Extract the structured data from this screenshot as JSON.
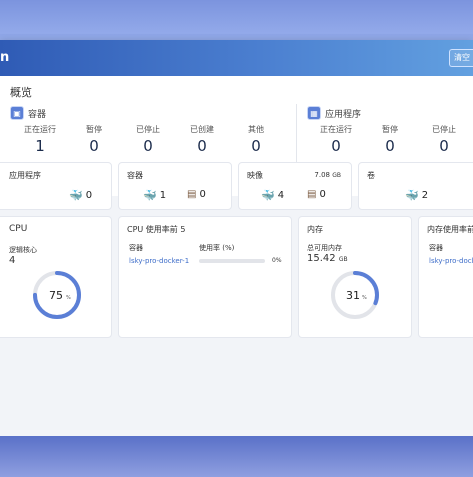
{
  "header": {
    "title": "n",
    "button_label": "清空"
  },
  "overview": {
    "title": "概览",
    "containers": {
      "label": "容器",
      "stats": [
        {
          "label": "正在运行",
          "value": "1"
        },
        {
          "label": "暂停",
          "value": "0"
        },
        {
          "label": "已停止",
          "value": "0"
        },
        {
          "label": "已创建",
          "value": "0"
        },
        {
          "label": "其他",
          "value": "0"
        }
      ]
    },
    "apps": {
      "label": "应用程序",
      "stats": [
        {
          "label": "正在运行",
          "value": "0"
        },
        {
          "label": "暂停",
          "value": "0"
        },
        {
          "label": "已停止",
          "value": "0"
        }
      ]
    }
  },
  "row1": {
    "apps": {
      "title": "应用程序",
      "value1": "0"
    },
    "containers": {
      "title": "容器",
      "value1": "1",
      "value2": "0"
    },
    "images": {
      "title": "映像",
      "size": "7.08",
      "size_unit": "GB",
      "value1": "4",
      "value2": "0"
    },
    "volumes": {
      "title": "卷",
      "value1": "2"
    }
  },
  "cpu": {
    "title": "CPU",
    "cores_label": "逻辑核心",
    "cores": "4",
    "percent": "75",
    "percent_unit": "%",
    "fraction": 0.75
  },
  "cpu_top": {
    "title": "CPU 使用率前 5",
    "col1": "容器",
    "col2": "使用率 (%)",
    "rows": [
      {
        "name": "lsky-pro-docker-1",
        "value": "0%",
        "fraction": 0.0
      }
    ]
  },
  "memory": {
    "title": "内存",
    "avail_label": "总可用内存",
    "avail_value": "15.42",
    "avail_unit": "GB",
    "percent": "31",
    "percent_unit": "%",
    "fraction": 0.31
  },
  "mem_top": {
    "title": "内存使用率前",
    "col1": "容器",
    "rows": [
      {
        "name": "lsky-pro-dock"
      }
    ]
  },
  "colors": {
    "accent": "#5b7fd6",
    "track": "#e2e4e9",
    "header": "#2f5bb5"
  }
}
